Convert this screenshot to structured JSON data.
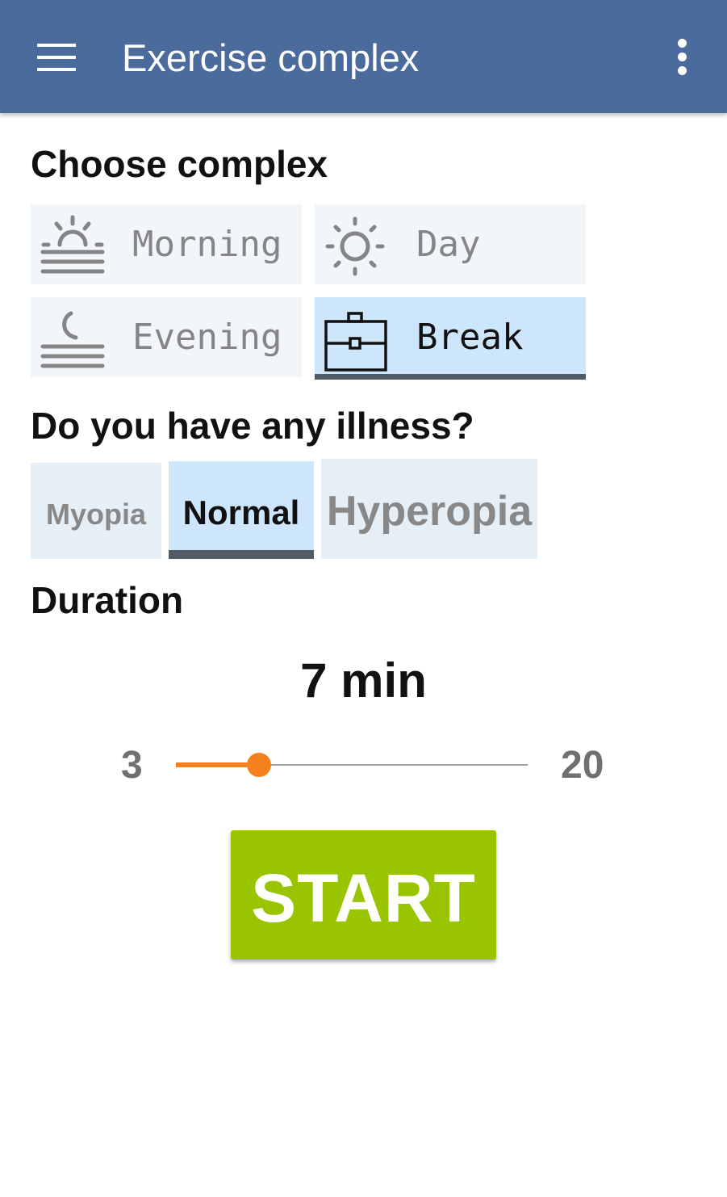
{
  "appbar": {
    "title": "Exercise complex",
    "menu_icon": "hamburger-menu-icon",
    "more_icon": "more-vertical-icon",
    "color": "#4a6b9c"
  },
  "complex": {
    "heading": "Choose complex",
    "selected": "Break",
    "options": [
      {
        "label": "Morning",
        "icon": "sunrise-icon",
        "selected": false
      },
      {
        "label": "Day",
        "icon": "sun-icon",
        "selected": false
      },
      {
        "label": "Evening",
        "icon": "moonset-icon",
        "selected": false
      },
      {
        "label": "Break",
        "icon": "briefcase-icon",
        "selected": true
      }
    ]
  },
  "illness": {
    "heading": "Do you have any illness?",
    "selected": "Normal",
    "options": [
      {
        "label": "Myopia",
        "selected": false
      },
      {
        "label": "Normal",
        "selected": true
      },
      {
        "label": "Hyperopia",
        "selected": false
      }
    ]
  },
  "duration": {
    "heading": "Duration",
    "value_label": "7 min",
    "value": 7,
    "min_label": "3",
    "max_label": "20",
    "min": 3,
    "max": 20,
    "accent": "#f5811e"
  },
  "start_button": {
    "label": "START",
    "color": "#99c400"
  }
}
